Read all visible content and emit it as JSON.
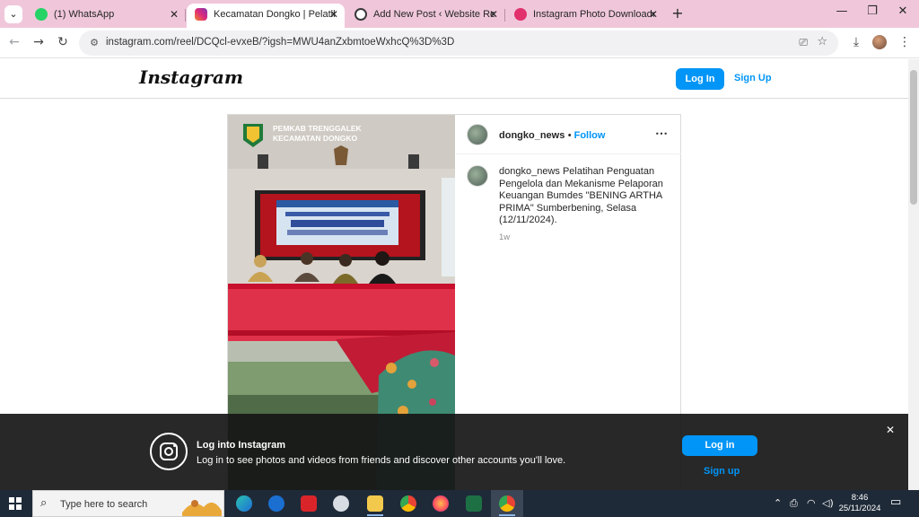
{
  "browser": {
    "tabs": [
      {
        "title": "(1) WhatsApp",
        "favicon": "whatsapp-icon",
        "color": "#25d366"
      },
      {
        "title": "Kecamatan Dongko | Pelatihan",
        "favicon": "instagram-icon",
        "color": "#e1306c"
      },
      {
        "title": "Add New Post ‹ Website Resmi",
        "favicon": "wordpress-icon",
        "color": "#3a3a3a"
      },
      {
        "title": "Instagram Photo Downloader -",
        "favicon": "downloader-icon",
        "color": "#e1306c"
      }
    ],
    "url": "instagram.com/reel/DCQcl-evxeB/?igsh=MWU4anZxbmtoeWxhcQ%3D%3D"
  },
  "header": {
    "logo": "Instagram",
    "login_label": "Log In",
    "signup_label": "Sign Up"
  },
  "post": {
    "username": "dongko_news",
    "follow_label": "Follow",
    "caption_user": "dongko_news",
    "caption_text": "Pelatihan Penguatan Pengelola dan Mekanisme Pelaporan Keuangan Bumdes \"BENING ARTHA PRIMA\" Sumberbening, Selasa (12/11/2024).",
    "time": "1w",
    "image": {
      "banner_line1": "PEMKAB TRENGGALEK",
      "banner_line2": "KECAMATAN DONGKO"
    }
  },
  "login_overlay": {
    "title": "Log into Instagram",
    "subtitle": "Log in to see photos and videos from friends and discover other accounts you'll love.",
    "login_label": "Log in",
    "signup_label": "Sign up"
  },
  "taskbar": {
    "search_placeholder": "Type here to search",
    "time": "8:46",
    "date": "25/11/2024"
  },
  "colors": {
    "accent": "#0095f6",
    "tabstrip": "#f0c7da",
    "taskbar": "#1f2a38"
  }
}
